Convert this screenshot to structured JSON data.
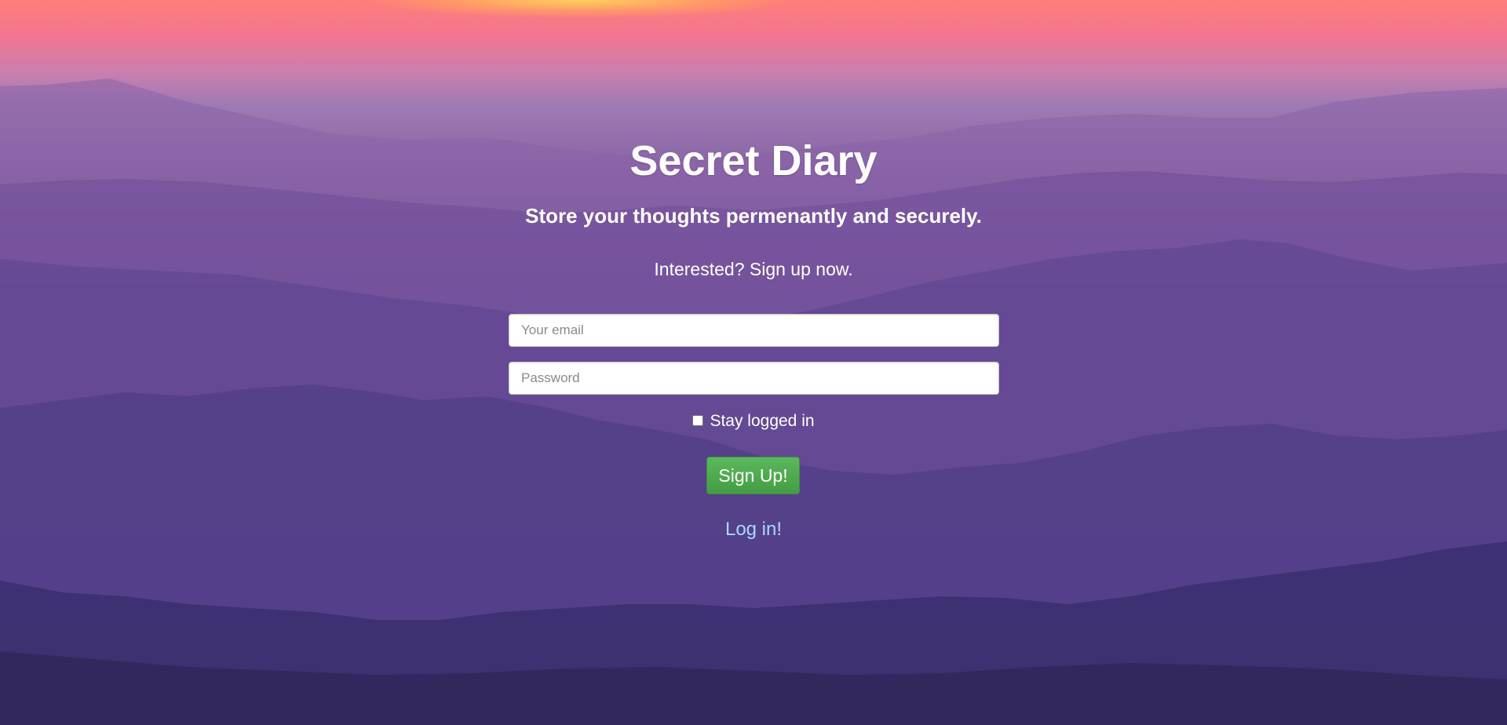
{
  "page": {
    "title": "Secret Diary",
    "tagline": "Store your thoughts permenantly and securely.",
    "prompt": "Interested? Sign up now."
  },
  "form": {
    "email_placeholder": "Your email",
    "email_value": "",
    "password_placeholder": "Password",
    "password_value": "",
    "stay_logged_in_label": "Stay logged in",
    "stay_logged_in_checked": false,
    "submit_label": "Sign Up!",
    "toggle_link_label": "Log in!"
  },
  "colors": {
    "button": "#5cb85c",
    "link": "#a9d8ff",
    "text": "#ffffff"
  }
}
